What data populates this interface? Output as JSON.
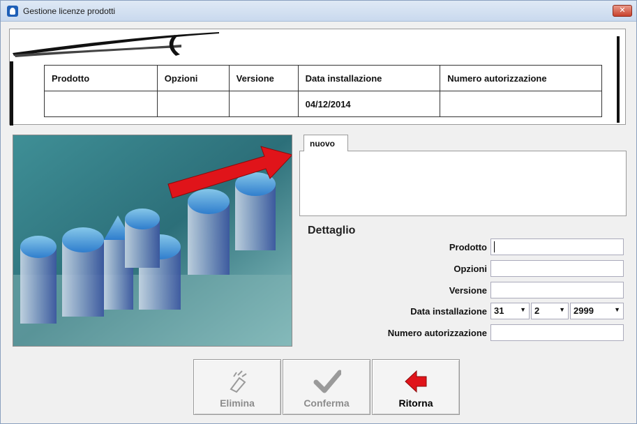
{
  "window": {
    "title": "Gestione licenze prodotti",
    "close_glyph": "✕"
  },
  "grid": {
    "columns": [
      "Prodotto",
      "Opzioni",
      "Versione",
      "Data installazione",
      "Numero autorizzazione"
    ],
    "rows": [
      [
        "",
        "",
        "",
        "04/12/2014",
        ""
      ]
    ]
  },
  "tabs": [
    {
      "label": "nuovo",
      "selected": true
    }
  ],
  "detail": {
    "section_label": "Dettaglio",
    "prodotto_label": "Prodotto",
    "prodotto_value": "",
    "opzioni_label": "Opzioni",
    "opzioni_value": "",
    "versione_label": "Versione",
    "versione_value": "",
    "data_label": "Data installazione",
    "data_day": "31",
    "data_month": "2",
    "data_year": "2999",
    "numero_label": "Numero autorizzazione",
    "numero_value": ""
  },
  "buttons": {
    "elimina": {
      "label": "Elimina",
      "icon": "eraser-icon",
      "enabled": false
    },
    "conferma": {
      "label": "Conferma",
      "icon": "checkmark-icon",
      "enabled": false
    },
    "ritorna": {
      "label": "Ritorna",
      "icon": "red-arrow-left-icon",
      "enabled": true
    }
  },
  "colors": {
    "accent_red": "#e0141a",
    "disabled_text": "#8c8c8c"
  }
}
